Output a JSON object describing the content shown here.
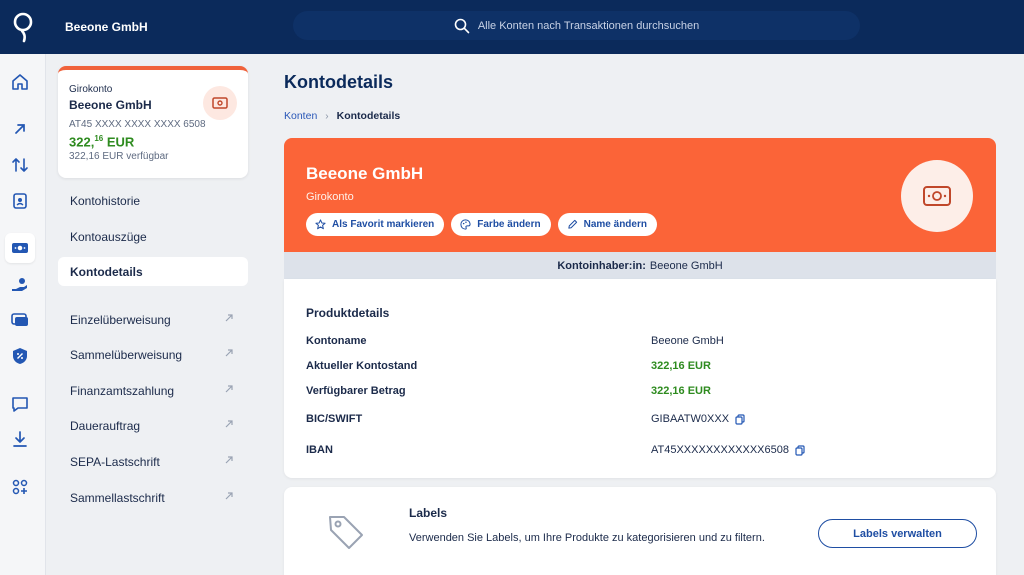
{
  "header": {
    "org_name": "Beeone GmbH",
    "search_placeholder": "Alle Konten nach Transaktionen durchsuchen"
  },
  "rail": {
    "icons": [
      "home-icon",
      "arrow-up-right-icon",
      "transfer-arrows-icon",
      "contacts-book-icon",
      "account-money-icon",
      "hand-coin-icon",
      "cards-icon",
      "shield-percent-icon",
      "chat-icon",
      "download-icon",
      "apps-plus-icon"
    ],
    "active": "account-money-icon"
  },
  "account_card": {
    "type": "Girokonto",
    "name": "Beeone GmbH",
    "iban": "AT45 XXXX XXXX XXXX 6508",
    "balance_main": "322,",
    "balance_cents": "16",
    "balance_currency": " EUR",
    "available": "322,16 EUR verfügbar",
    "accent_color": "#f0623b"
  },
  "nav": {
    "items": [
      {
        "label": "Kontohistorie"
      },
      {
        "label": "Kontoauszüge"
      },
      {
        "label": "Kontodetails"
      },
      {
        "label": "Einzelüberweisung"
      },
      {
        "label": "Sammelüberweisung"
      },
      {
        "label": "Finanzamtszahlung"
      },
      {
        "label": "Dauerauftrag"
      },
      {
        "label": "SEPA-Lastschrift"
      },
      {
        "label": "Sammellastschrift"
      }
    ],
    "active": "Kontodetails"
  },
  "main": {
    "title": "Kontodetails",
    "breadcrumb": {
      "link": "Konten",
      "current": "Kontodetails"
    }
  },
  "hero": {
    "title": "Beeone GmbH",
    "subtitle": "Girokonto",
    "favorite_label": "Als Favorit markieren",
    "color_label": "Farbe ändern",
    "rename_label": "Name ändern",
    "background_color": "#fb6438"
  },
  "owner": {
    "label": "Kontoinhaber:in:",
    "value": "Beeone GmbH"
  },
  "details": {
    "title": "Produktdetails",
    "rows": [
      {
        "label": "Kontoname",
        "value": "Beeone GmbH"
      },
      {
        "label": "Aktueller Kontostand",
        "value": "322,16 EUR"
      },
      {
        "label": "Verfügbarer Betrag",
        "value": "322,16 EUR"
      },
      {
        "label": "BIC/SWIFT",
        "value": "GIBAATW0XXX"
      },
      {
        "label": "IBAN",
        "value": "AT45XXXXXXXXXXXX6508"
      }
    ]
  },
  "labels": {
    "title": "Labels",
    "description": "Verwenden Sie Labels, um Ihre Produkte zu kategorisieren und zu filtern.",
    "button": "Labels verwalten"
  }
}
